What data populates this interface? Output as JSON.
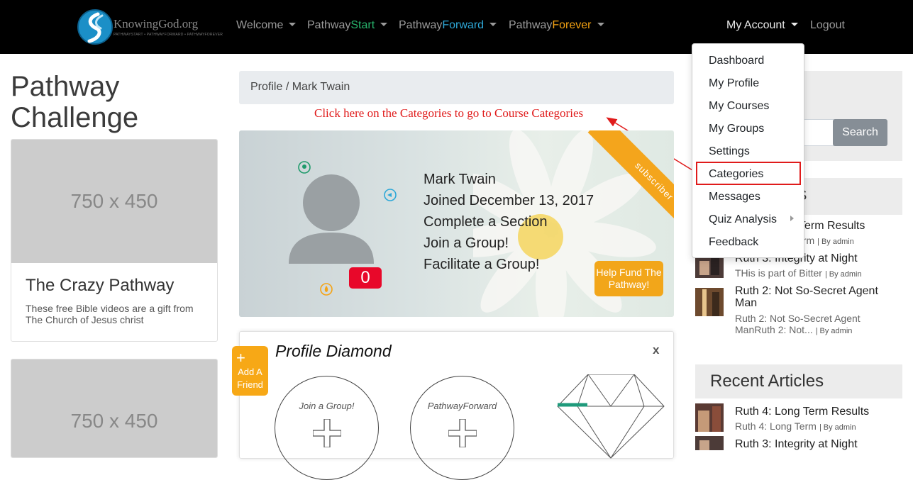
{
  "brand": {
    "name": "KnowingGod.org",
    "subtitle": "PATHWAYSTART • PATHWAYFORWARD • PATHWAYFOREVER"
  },
  "nav": {
    "welcome": "Welcome",
    "pathway": "Pathway",
    "start": "Start",
    "forward": "Forward",
    "forever": "Forever",
    "my_account": "My Account",
    "logout": "Logout"
  },
  "dropdown": {
    "items": [
      "Dashboard",
      "My Profile",
      "My Courses",
      "My Groups",
      "Settings",
      "Categories",
      "Messages",
      "Quiz Analysis",
      "Feedback"
    ]
  },
  "left": {
    "title_line1": "Pathway",
    "title_line2": "Challenge",
    "cards": [
      {
        "image": "750 x 450",
        "title": "The Crazy Pathway",
        "text": "These free Bible videos are a gift from The Church of Jesus christ"
      },
      {
        "image": "750 x 450"
      }
    ]
  },
  "breadcrumb": {
    "parent": "Profile",
    "separator": "/",
    "current": "Mark Twain"
  },
  "annotation": "Click here on the Categories to go to Course Categories",
  "profile": {
    "ribbon": "subscriber",
    "name": "Mark Twain",
    "joined": "Joined December 13, 2017",
    "tasks": [
      "Complete a Section",
      "Join a Group!",
      "Facilitate a Group!"
    ],
    "points": "0",
    "help_fund": "Help Fund The Pathway!"
  },
  "diamond": {
    "title": "Profile Diamond",
    "close": "x",
    "add_friend": "Add A Friend",
    "add_plus": "+",
    "circles": [
      "Join a Group!",
      "PathwayForward"
    ]
  },
  "sidebar": {
    "search_button": "Search",
    "partial_heading": "S",
    "recent_posts": [
      {
        "title": "Term Results",
        "meta": "erm",
        "by": "By admin"
      },
      {
        "title": "Ruth 3: Integrity at Night",
        "meta": "THis is part of Bitter",
        "by": "By admin"
      },
      {
        "title": "Ruth 2: Not So-Secret Agent Man",
        "meta": "Ruth 2: Not So-Secret Agent ManRuth 2: Not...",
        "by": "By admin"
      }
    ],
    "recent_articles_title": "Recent Articles",
    "recent_articles": [
      {
        "title": "Ruth 4: Long Term Results",
        "meta": "Ruth 4: Long Term",
        "by": "By admin"
      },
      {
        "title": "Ruth 3: Integrity at Night"
      }
    ]
  }
}
